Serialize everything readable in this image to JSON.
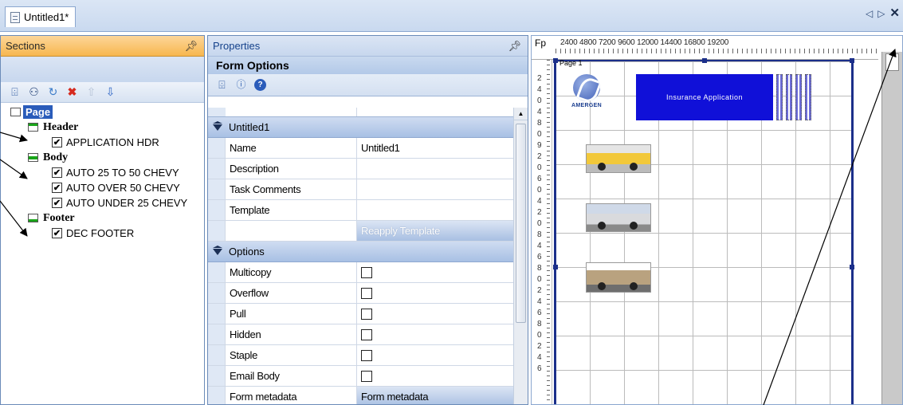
{
  "tab": {
    "title": "Untitled1*"
  },
  "nav": {
    "prev": "◁",
    "next": "▷",
    "close": "✕"
  },
  "sections": {
    "title": "Sections",
    "pin": "ᵖ",
    "tree": {
      "page": "Page",
      "groups": [
        {
          "label": "Header",
          "items": [
            "APPLICATION HDR"
          ]
        },
        {
          "label": "Body",
          "items": [
            "AUTO 25 TO 50 CHEVY",
            "AUTO OVER 50 CHEVY",
            "AUTO UNDER 25 CHEVY"
          ]
        },
        {
          "label": "Footer",
          "items": [
            "DEC FOOTER"
          ]
        }
      ]
    }
  },
  "properties": {
    "title": "Properties",
    "pin": "ᵖ",
    "section_title": "Form Options",
    "categories": [
      {
        "label": "Untitled1",
        "rows": [
          {
            "key": "Name",
            "value": "Untitled1"
          },
          {
            "key": "Description",
            "value": ""
          },
          {
            "key": "Task Comments",
            "value": ""
          },
          {
            "key": "Template",
            "value": ""
          },
          {
            "key": "",
            "value": "Reapply Template"
          }
        ]
      },
      {
        "label": "Options",
        "rows": [
          {
            "key": "Multicopy",
            "value": ""
          },
          {
            "key": "Overflow",
            "value": ""
          },
          {
            "key": "Pull",
            "value": ""
          },
          {
            "key": "Hidden",
            "value": ""
          },
          {
            "key": "Staple",
            "value": ""
          },
          {
            "key": "Email Body",
            "value": ""
          },
          {
            "key": "Form metadata",
            "value": "Form metadata"
          }
        ]
      }
    ]
  },
  "designer": {
    "fp": "Fp",
    "ruler_labels": "2400 4800 7200 9600 12000 14400 16800 19200",
    "page_label": "Page 1",
    "logo_text": "AMERGEN",
    "banner_text": "Insurance Application",
    "ruler_left_digits": [
      "2",
      "4",
      "0",
      "4",
      "8",
      "0",
      "9",
      "2",
      "0",
      "6",
      "0",
      "4",
      "2",
      "0",
      "8",
      "4",
      "6",
      "8",
      "0",
      "2",
      "4",
      "6",
      "8",
      "0",
      "2",
      "4",
      "6"
    ]
  },
  "colors": {
    "accent": "#2a5cba",
    "sections_header": "#f7b74f",
    "banner": "#1010d8",
    "page_border": "#1b2f8a"
  }
}
